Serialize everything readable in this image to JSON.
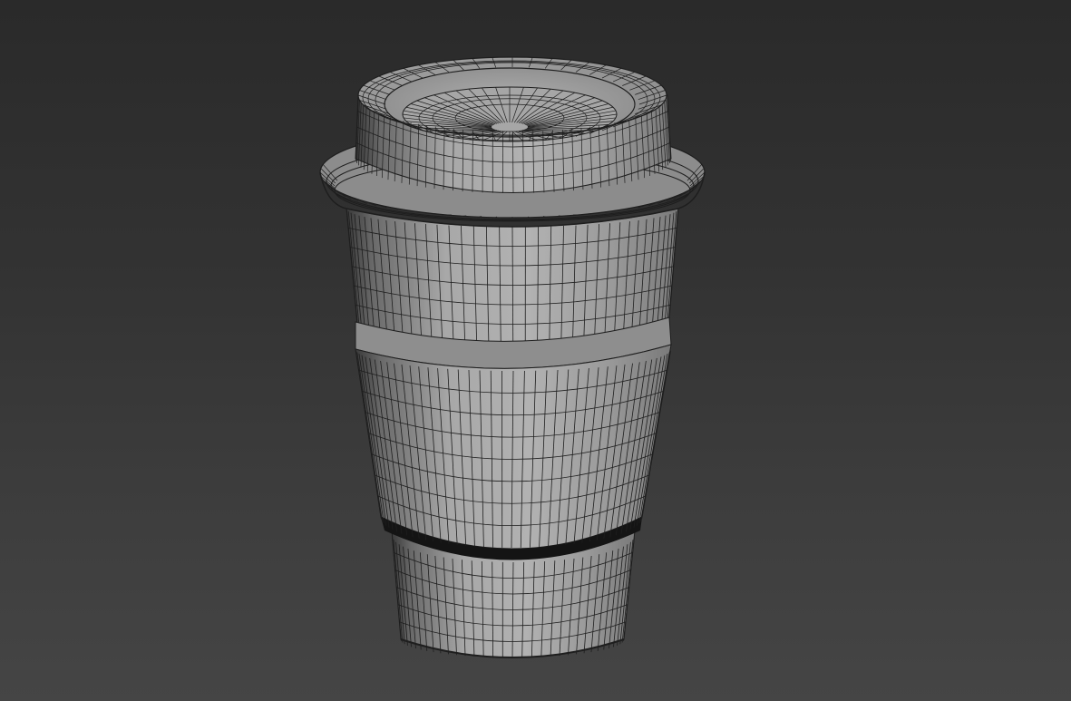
{
  "viewport": {
    "label": "",
    "background_top": "#2a2a2a",
    "background_bottom": "#454545"
  },
  "model": {
    "name": "takeaway-coffee-cup",
    "shading": "wireframe-over-shaded",
    "parts": [
      "lid",
      "lid-rim",
      "cup-body",
      "cup-sleeve",
      "cup-bottom"
    ],
    "surface_color": "#9a9a9a",
    "wire_color": "#1e1e1e"
  }
}
